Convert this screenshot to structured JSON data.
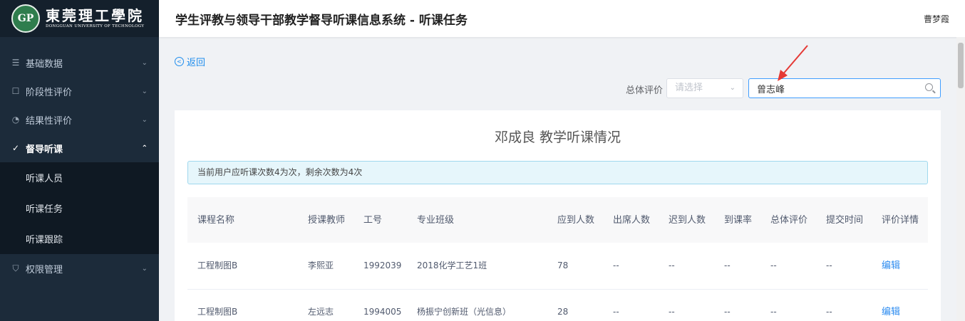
{
  "logo": {
    "badge": "GP",
    "name_cn": "東莞理工學院",
    "name_en": "DONGGUAN UNIVERSITY OF TECHNOLOGY"
  },
  "sidebar": {
    "items": [
      {
        "label": "基础数据",
        "icon": "list-icon"
      },
      {
        "label": "阶段性评价",
        "icon": "edit-square-icon"
      },
      {
        "label": "结果性评价",
        "icon": "gauge-icon"
      },
      {
        "label": "督导听课",
        "icon": "check-circle-icon",
        "active": true
      },
      {
        "label": "权限管理",
        "icon": "shield-icon"
      }
    ],
    "subitems": [
      "听课人员",
      "听课任务",
      "听课跟踪"
    ]
  },
  "header": {
    "title": "学生评教与领导干部教学督导听课信息系统 - 听课任务",
    "user": "曹梦霞"
  },
  "toolbar": {
    "back_label": "返回",
    "filter_label": "总体评价",
    "select_placeholder": "请选择",
    "search_value": "曾志峰"
  },
  "card": {
    "title": "邓成良  教学听课情况",
    "alert": "当前用户应听课次数4为次，剩余次数为4次"
  },
  "table": {
    "headers": [
      "课程名称",
      "授课教师",
      "工号",
      "专业班级",
      "应到人数",
      "出席人数",
      "迟到人数",
      "到课率",
      "总体评价",
      "提交时间",
      "评价详情"
    ],
    "rows": [
      [
        "工程制图B",
        "李熙亚",
        "1992039",
        "2018化学工艺1班",
        "78",
        "--",
        "--",
        "--",
        "--",
        "--",
        "编辑"
      ],
      [
        "工程制图B",
        "左远志",
        "1994005",
        "杨振宁创新班（光信息）",
        "28",
        "--",
        "--",
        "--",
        "--",
        "--",
        "编辑"
      ]
    ]
  },
  "colors": {
    "sidebar_bg": "#1c2b3a",
    "accent": "#409eff",
    "link": "#2d8cf0",
    "arrow": "#e53935"
  }
}
